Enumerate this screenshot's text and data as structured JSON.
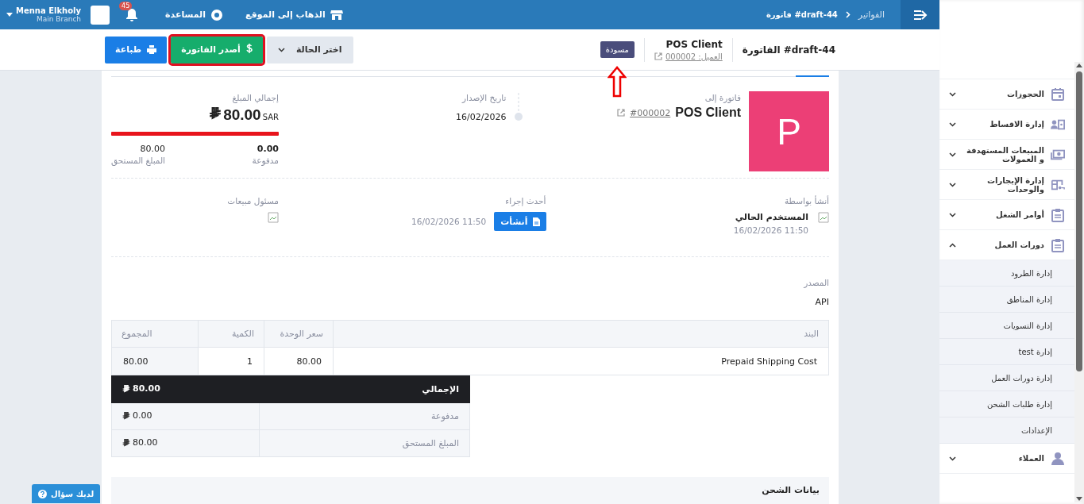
{
  "topbar": {
    "breadcrumb": [
      {
        "label": "الفواتير",
        "current": false
      },
      {
        "label": "فاتورة #draft-44",
        "current": true
      }
    ],
    "links": [
      {
        "kind": "store",
        "label": "الذهاب إلى الموقع"
      },
      {
        "kind": "help",
        "label": "المساعدة"
      }
    ],
    "notifications": "45",
    "user": {
      "name": "Menna Elkholy",
      "branch": "Main Branch"
    }
  },
  "header": {
    "title": "الفاتورة #draft-44",
    "client": "POS Client",
    "client_link": "العميل: 000002",
    "status": "مسودة",
    "status_pointed": true,
    "buttons": [
      {
        "kind": "status",
        "label": "اختر الحالة",
        "highlighted": false
      },
      {
        "kind": "issue",
        "label": "أصدر الفاتورة",
        "highlighted": true
      },
      {
        "kind": "print",
        "label": "طباعة",
        "highlighted": false
      }
    ]
  },
  "summary": {
    "bill_to_label": "فاتورة إلى",
    "avatar": "P",
    "client": "POS Client",
    "client_code": "#000002",
    "issue_date_label": "تاريخ الإصدار",
    "issue_date": "16/02/2026",
    "total_label": "إجمالي المبلغ",
    "currency": "SAR",
    "total": "80.00",
    "level": 0,
    "paid": "0.00",
    "paid_label": "مدفوعة",
    "due": "80.00",
    "due_label": "المبلغ المستحق"
  },
  "activity": {
    "created_by_label": "أنشأ بواسطة",
    "created_by": "المستخدم الحالي",
    "created_time": "11:50 16/02/2026",
    "last_action_label": "أحدث إجراء",
    "last_action": "أنشأت",
    "last_action_time": "11:50 16/02/2026",
    "sales_rep_label": "مسئول مبيعات"
  },
  "source": {
    "label": "المصدر",
    "value": "API"
  },
  "table": {
    "columns": [
      "البند",
      "سعر الوحدة",
      "الكمية",
      "المجموع"
    ],
    "rows": [
      [
        "Prepaid Shipping Cost",
        "80.00",
        "1",
        "80.00"
      ]
    ]
  },
  "totals": [
    {
      "kind": "total",
      "label": "الإجمالي",
      "value": "80.00"
    },
    {
      "kind": "line",
      "label": "مدفوعة",
      "value": "0.00"
    },
    {
      "kind": "line",
      "label": "المبلغ المستحق",
      "value": "80.00"
    }
  ],
  "shipping": {
    "title": "بيانات الشحن"
  },
  "help_button": "لديك سؤال",
  "sidebar": {
    "items": [
      {
        "kind": "calendar",
        "label": "الحجوزات",
        "expanded": false
      },
      {
        "kind": "person-card",
        "label": "إدارة الاقساط",
        "expanded": false
      },
      {
        "kind": "money",
        "label": "المبيعات المستهدفة و العمولات",
        "expanded": false
      },
      {
        "kind": "key-grid",
        "label": "إدارة الإيجارات والوحدات",
        "expanded": false
      },
      {
        "kind": "clipboard",
        "label": "أوامر الشغل",
        "expanded": false
      },
      {
        "kind": "clipboard",
        "label": "دورات العمل",
        "expanded": true,
        "children": [
          {
            "label": "إدارة الطرود"
          },
          {
            "label": "إدارة المناطق"
          },
          {
            "label": "إدارة التسويات"
          },
          {
            "label": "إدارة test"
          },
          {
            "label": "إدارة دورات العمل"
          },
          {
            "label": "إدارة طلبات الشحن"
          },
          {
            "label": "الإعدادات"
          }
        ]
      },
      {
        "kind": "user",
        "label": "العملاء",
        "expanded": false
      }
    ]
  }
}
